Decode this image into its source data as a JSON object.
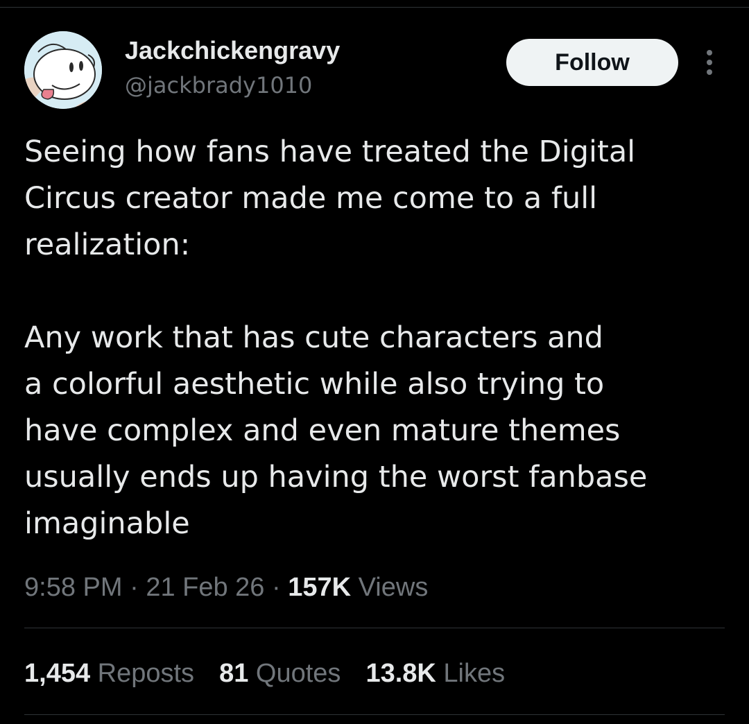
{
  "author": {
    "display_name": "Jackchickengravy",
    "handle": "@jackbrady1010"
  },
  "follow_label": "Follow",
  "tweet": {
    "paragraphs": [
      "Seeing how fans have treated the Digital\nCircus creator made me come to a full\nrealization:",
      "Any work that has cute characters and\na colorful aesthetic while also trying to\nhave complex and even mature themes\nusually ends up having the worst fanbase\nimaginable"
    ]
  },
  "meta": {
    "time": "9:58 PM",
    "separator": "·",
    "date": "21 Feb 26",
    "views_count": "157K",
    "views_label": "Views"
  },
  "stats": {
    "reposts_count": "1,454",
    "reposts_label": "Reposts",
    "quotes_count": "81",
    "quotes_label": "Quotes",
    "likes_count": "13.8K",
    "likes_label": "Likes"
  },
  "colors": {
    "background": "#000000",
    "primary_text": "#e7e9ea",
    "secondary_text": "#71767b",
    "divider": "#2f3336",
    "follow_button_bg": "#eff3f4",
    "follow_button_text": "#0f1419"
  },
  "icons": {
    "more": "more-vertical-icon"
  }
}
